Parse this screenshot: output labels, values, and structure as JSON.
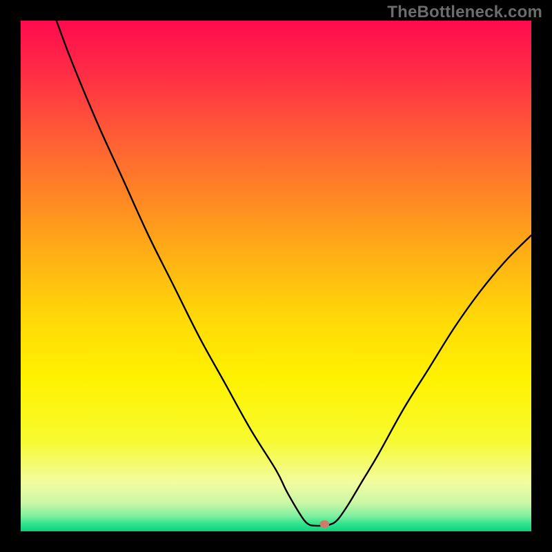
{
  "watermark": "TheBottleneck.com",
  "chart_data": {
    "type": "line",
    "title": "",
    "xlabel": "",
    "ylabel": "",
    "xlim": [
      0,
      100
    ],
    "ylim": [
      0,
      100
    ],
    "grid": false,
    "curve": {
      "name": "bottleneck-curve",
      "color": "#000000",
      "points": [
        {
          "x": 7,
          "y": 100
        },
        {
          "x": 10,
          "y": 92
        },
        {
          "x": 15,
          "y": 80
        },
        {
          "x": 20,
          "y": 69
        },
        {
          "x": 25,
          "y": 58
        },
        {
          "x": 30,
          "y": 48
        },
        {
          "x": 35,
          "y": 38
        },
        {
          "x": 40,
          "y": 29
        },
        {
          "x": 45,
          "y": 20
        },
        {
          "x": 50,
          "y": 12
        },
        {
          "x": 52,
          "y": 8
        },
        {
          "x": 54,
          "y": 4.5
        },
        {
          "x": 55.5,
          "y": 2.2
        },
        {
          "x": 56.5,
          "y": 1.3
        },
        {
          "x": 57.5,
          "y": 1.1
        },
        {
          "x": 59,
          "y": 1.1
        },
        {
          "x": 60.5,
          "y": 1.3
        },
        {
          "x": 62,
          "y": 2.2
        },
        {
          "x": 64,
          "y": 5
        },
        {
          "x": 67,
          "y": 10
        },
        {
          "x": 70,
          "y": 15
        },
        {
          "x": 75,
          "y": 24
        },
        {
          "x": 80,
          "y": 32
        },
        {
          "x": 85,
          "y": 40
        },
        {
          "x": 90,
          "y": 47
        },
        {
          "x": 95,
          "y": 53
        },
        {
          "x": 100,
          "y": 58
        }
      ]
    },
    "marker": {
      "x": 59.5,
      "y": 1.4,
      "color": "#d17a6b"
    },
    "gradient_stops": [
      {
        "pos": 0.0,
        "color": "#ff0b4e"
      },
      {
        "pos": 0.1,
        "color": "#ff2c45"
      },
      {
        "pos": 0.22,
        "color": "#ff5a36"
      },
      {
        "pos": 0.34,
        "color": "#ff8525"
      },
      {
        "pos": 0.46,
        "color": "#ffb015"
      },
      {
        "pos": 0.58,
        "color": "#ffd808"
      },
      {
        "pos": 0.7,
        "color": "#fff200"
      },
      {
        "pos": 0.82,
        "color": "#f7fa2e"
      },
      {
        "pos": 0.905,
        "color": "#f2fca0"
      },
      {
        "pos": 0.945,
        "color": "#c9f7a6"
      },
      {
        "pos": 0.97,
        "color": "#7ef0a0"
      },
      {
        "pos": 0.985,
        "color": "#33e38e"
      },
      {
        "pos": 1.0,
        "color": "#0ad47d"
      }
    ],
    "legend": null,
    "annotations": []
  }
}
